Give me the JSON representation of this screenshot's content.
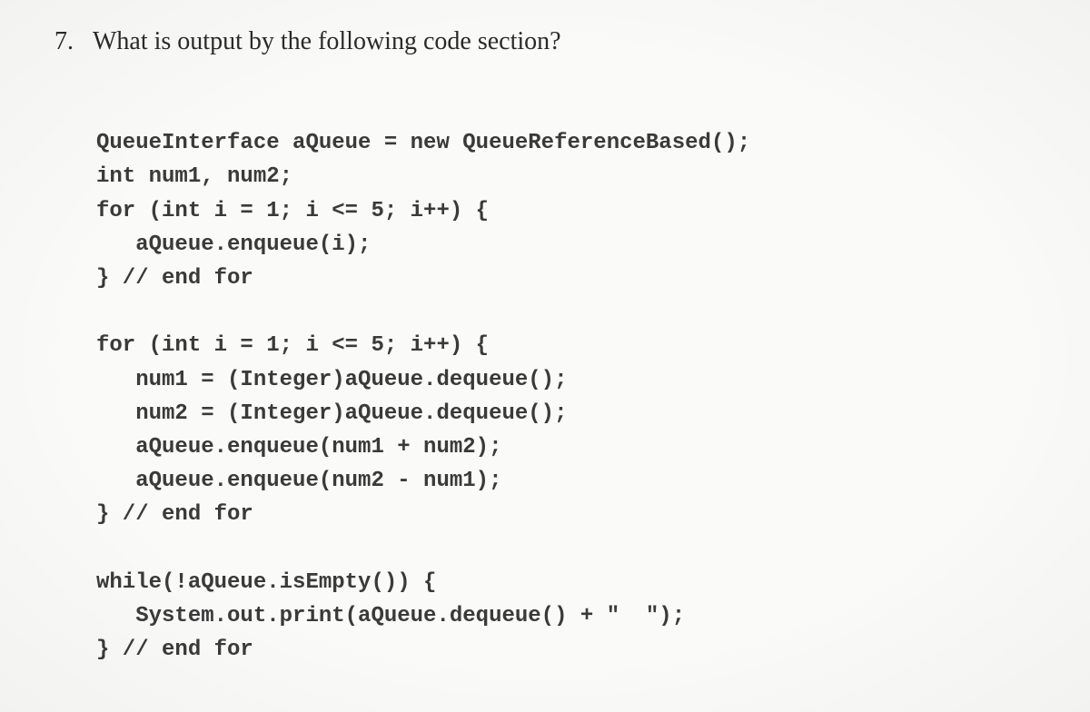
{
  "question": {
    "number": "7.",
    "text": "What is output by the following code section?"
  },
  "code": {
    "line1": "QueueInterface aQueue = new QueueReferenceBased();",
    "line2": "int num1, num2;",
    "line3": "for (int i = 1; i <= 5; i++) {",
    "line4": "   aQueue.enqueue(i);",
    "line5": "} // end for",
    "blank1": "",
    "line6": "for (int i = 1; i <= 5; i++) {",
    "line7": "   num1 = (Integer)aQueue.dequeue();",
    "line8": "   num2 = (Integer)aQueue.dequeue();",
    "line9": "   aQueue.enqueue(num1 + num2);",
    "line10": "   aQueue.enqueue(num2 - num1);",
    "line11": "} // end for",
    "blank2": "",
    "line12": "while(!aQueue.isEmpty()) {",
    "line13": "   System.out.print(aQueue.dequeue() + \"  \");",
    "line14": "} // end for"
  }
}
